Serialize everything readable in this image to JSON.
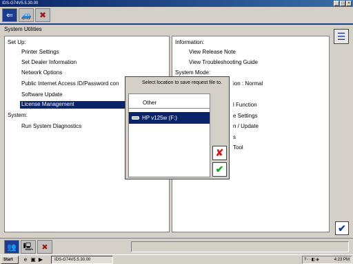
{
  "window": {
    "title": "IDS-G74V5.5.30.00",
    "controls": [
      "_",
      "□",
      "×"
    ]
  },
  "toolbar": {
    "tabs": [
      {
        "icon": "back-arrow-icon",
        "glyph": "⇐"
      },
      {
        "icon": "car-icon",
        "glyph": "🚙"
      },
      {
        "icon": "wrench-tools-icon",
        "glyph": "✖"
      }
    ]
  },
  "section": {
    "title": "System Utilities"
  },
  "left_panel": {
    "setup_heading": "Set Up:",
    "items": [
      "Printer Settings",
      "Set Dealer Information",
      "Network Options",
      "Public Internet Access ID/Password con",
      "Software Update",
      "License Management"
    ],
    "selected": "License Management",
    "system_heading": "System:",
    "system_items": [
      "Run System Diagnostics"
    ]
  },
  "right_panel": {
    "information_heading": "Information:",
    "information_items": [
      "View Release Note",
      "View Troubleshooting Guide"
    ],
    "system_mode_heading": "System Mode:",
    "partial_items": [
      "ion : Normal",
      "l Function",
      "e Settings",
      "n / Update",
      "s",
      "Tool"
    ]
  },
  "dialog": {
    "label": "Select location to save request file to.",
    "options": [
      "Other",
      "HP v125w (F:)"
    ],
    "selected": "HP v125w (F:)",
    "cancel_glyph": "✘",
    "ok_glyph": "✔"
  },
  "bottom": {
    "confirm_glyph": "✔",
    "tabs": [
      {
        "icon": "people-icon",
        "glyph": "👥"
      },
      {
        "icon": "computer-icon",
        "glyph": "🖳"
      },
      {
        "icon": "tools-icon",
        "glyph": "✖"
      }
    ]
  },
  "taskbar": {
    "start_label": "Start",
    "task_label": "IDS-G74V5.5.30.00",
    "clock": "4:23 PM",
    "tray_glyphs": "?◦◦◧◈"
  },
  "colors": {
    "accent": "#1c3d8f",
    "selection": "#0a246a",
    "background": "#d4d0c8"
  }
}
